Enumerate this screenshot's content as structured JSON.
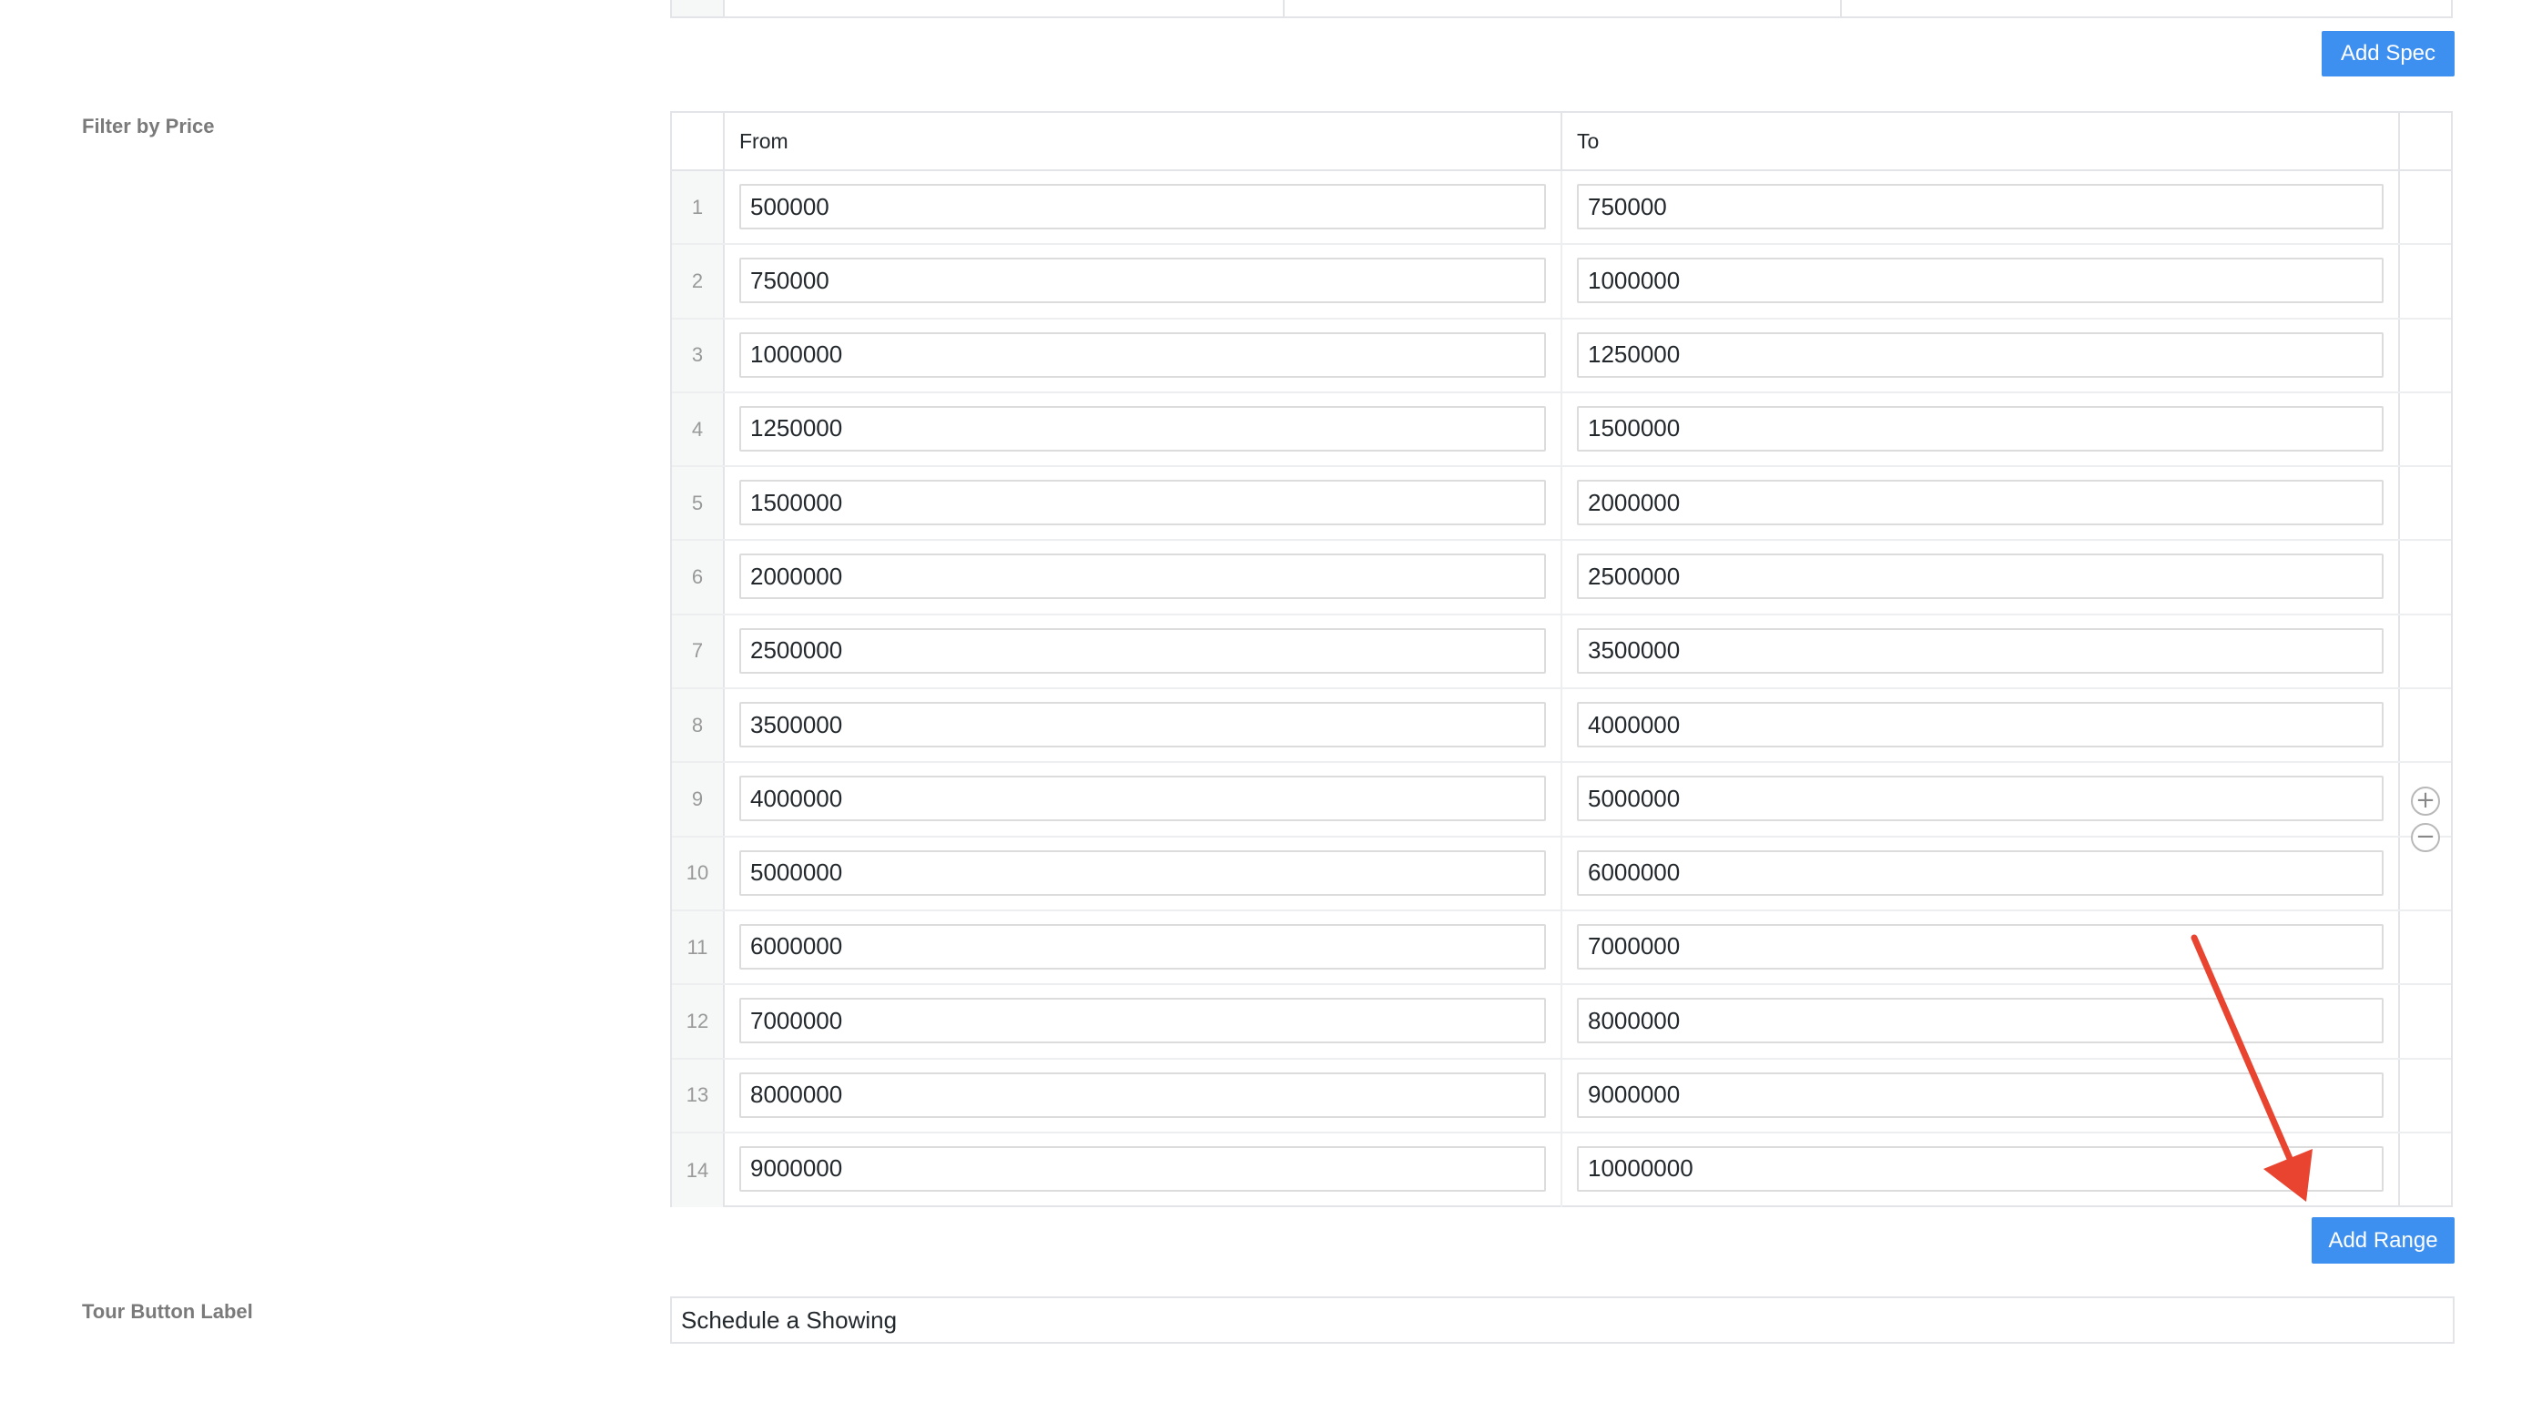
{
  "spec_section": {
    "add_spec_label": "Add Spec"
  },
  "price_filter": {
    "label": "Filter by Price",
    "columns": {
      "from": "From",
      "to": "To"
    },
    "rows": [
      {
        "index": "1",
        "from": "500000",
        "to": "750000"
      },
      {
        "index": "2",
        "from": "750000",
        "to": "1000000"
      },
      {
        "index": "3",
        "from": "1000000",
        "to": "1250000"
      },
      {
        "index": "4",
        "from": "1250000",
        "to": "1500000"
      },
      {
        "index": "5",
        "from": "1500000",
        "to": "2000000"
      },
      {
        "index": "6",
        "from": "2000000",
        "to": "2500000"
      },
      {
        "index": "7",
        "from": "2500000",
        "to": "3500000"
      },
      {
        "index": "8",
        "from": "3500000",
        "to": "4000000"
      },
      {
        "index": "9",
        "from": "4000000",
        "to": "5000000"
      },
      {
        "index": "10",
        "from": "5000000",
        "to": "6000000"
      },
      {
        "index": "11",
        "from": "6000000",
        "to": "7000000"
      },
      {
        "index": "12",
        "from": "7000000",
        "to": "8000000"
      },
      {
        "index": "13",
        "from": "8000000",
        "to": "9000000"
      },
      {
        "index": "14",
        "from": "9000000",
        "to": "10000000"
      }
    ],
    "add_row_icon": "plus-circle-icon",
    "remove_row_icon": "minus-circle-icon",
    "add_range_label": "Add Range"
  },
  "tour_button": {
    "label": "Tour Button Label",
    "value": "Schedule a Showing"
  },
  "colors": {
    "primary_button": "#3e90f0",
    "annotation_arrow": "#e8442f"
  }
}
